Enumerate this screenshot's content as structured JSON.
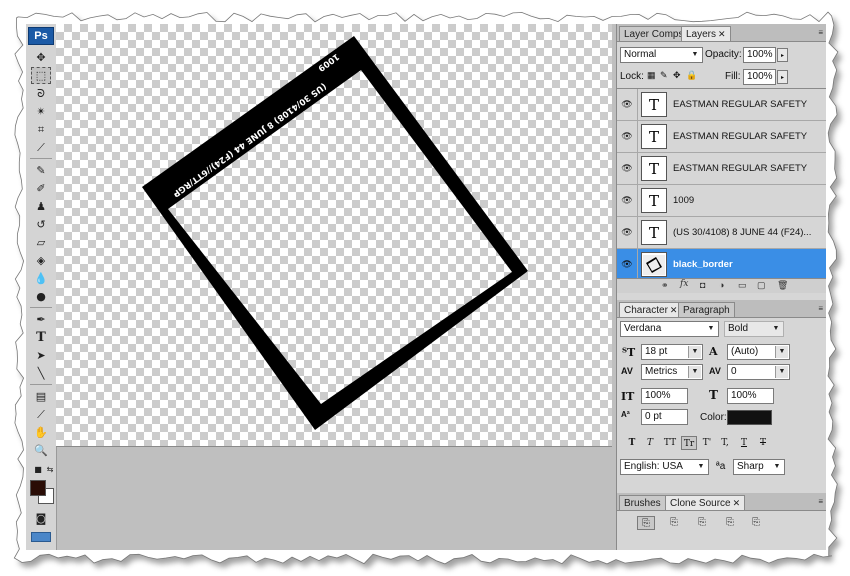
{
  "app": {
    "logo": "Ps"
  },
  "tools": {
    "icons": [
      "move-icon",
      "marquee-icon",
      "lasso-icon",
      "magic-wand-icon",
      "crop-icon",
      "eyedropper-icon",
      "healing-brush-icon",
      "brush-icon",
      "clone-stamp-icon",
      "history-brush-icon",
      "eraser-icon",
      "paint-bucket-icon",
      "blur-icon",
      "dodge-icon",
      "pen-icon",
      "type-icon",
      "path-selection-icon",
      "line-icon",
      "notes-icon",
      "eyedropper-2-icon",
      "hand-icon",
      "zoom-icon"
    ],
    "foreground_color": "#2a0d06",
    "background_color": "#ffffff"
  },
  "canvas": {
    "photo_edge_text_1": "(US 30/4108) 8 JUNE 44 (F24)//6TT/RGP",
    "photo_edge_text_2": "1009"
  },
  "layers_panel": {
    "tabs": [
      "Layer Comps",
      "Layers"
    ],
    "blend_mode": "Normal",
    "opacity_label": "Opacity:",
    "opacity_value": "100%",
    "lock_label": "Lock:",
    "fill_label": "Fill:",
    "fill_value": "100%",
    "layers": [
      {
        "name": "EASTMAN REGULAR SAFETY",
        "thumb": "T"
      },
      {
        "name": "EASTMAN REGULAR SAFETY",
        "thumb": "T"
      },
      {
        "name": "EASTMAN REGULAR SAFETY",
        "thumb": "T"
      },
      {
        "name": "1009",
        "thumb": "T"
      },
      {
        "name": "(US 30/4108) 8 JUNE 44 (F24)...",
        "thumb": "T"
      },
      {
        "name": "black_border",
        "thumb": ""
      }
    ],
    "selected_layer": 5
  },
  "character_panel": {
    "tabs": [
      "Character",
      "Paragraph"
    ],
    "font_family": "Verdana",
    "font_style": "Bold",
    "font_size": "18 pt",
    "leading": "(Auto)",
    "kerning": "Metrics",
    "tracking": "0",
    "vertical_scale": "100%",
    "horizontal_scale": "100%",
    "baseline_shift": "0 pt",
    "color_label": "Color:",
    "text_color": "#111111",
    "language": "English: USA",
    "antialias_label": "a",
    "antialias": "Sharp",
    "format_buttons": [
      "T",
      "T",
      "TT",
      "Tr",
      "T'",
      "T,",
      "T",
      "T"
    ]
  },
  "bottom_panel": {
    "tabs": [
      "Brushes",
      "Clone Source"
    ]
  }
}
